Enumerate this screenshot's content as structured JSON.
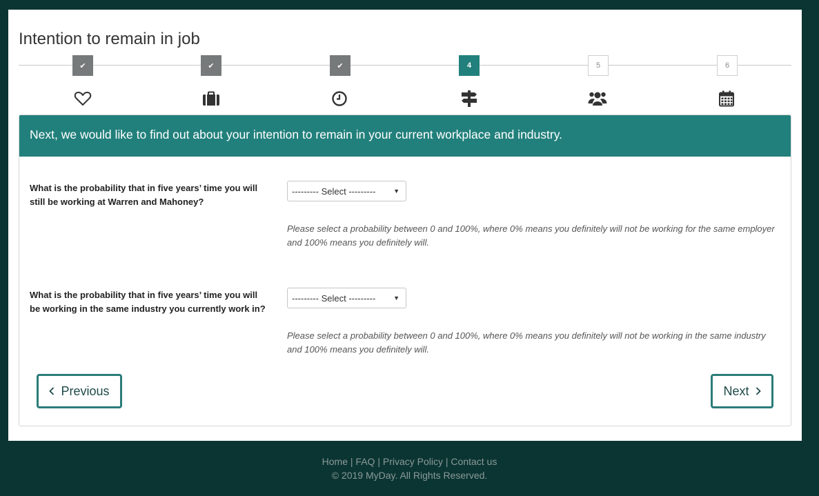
{
  "page": {
    "title": "Intention to remain in job"
  },
  "stepper": {
    "steps": [
      {
        "label": "",
        "state": "done",
        "icon": "heart-icon"
      },
      {
        "label": "",
        "state": "done",
        "icon": "briefcase-icon"
      },
      {
        "label": "",
        "state": "done",
        "icon": "clock-icon"
      },
      {
        "label": "4",
        "state": "current",
        "icon": "signpost-icon"
      },
      {
        "label": "5",
        "state": "future",
        "icon": "users-icon"
      },
      {
        "label": "6",
        "state": "future",
        "icon": "calendar-icon"
      }
    ],
    "done_glyph": "✔"
  },
  "panel": {
    "heading": "Next, we would like to find out about your intention to remain in your current workplace and industry.",
    "questions": [
      {
        "label": "What is the probability that in five years’ time you will still be working at Warren and Mahoney?",
        "select_value": "--------- Select ---------",
        "help": "Please select a probability between 0 and 100%, where 0% means you definitely will not be working for the same employer and 100% means you definitely will."
      },
      {
        "label": "What is the probability that in five years’ time you will be working in the same industry you currently work in?",
        "select_value": "--------- Select ---------",
        "help": "Please select a probability between 0 and 100%, where 0% means you definitely will not be working in the same industry and 100% means you definitely will."
      }
    ],
    "previous_label": "Previous",
    "next_label": "Next"
  },
  "footer": {
    "links": [
      "Home",
      "FAQ",
      "Privacy Policy",
      "Contact us"
    ],
    "copyright": "© 2019 MyDay. All Rights Reserved."
  },
  "colors": {
    "background": "#0b3533",
    "accent": "#22807c",
    "step_done": "#777a7a"
  }
}
